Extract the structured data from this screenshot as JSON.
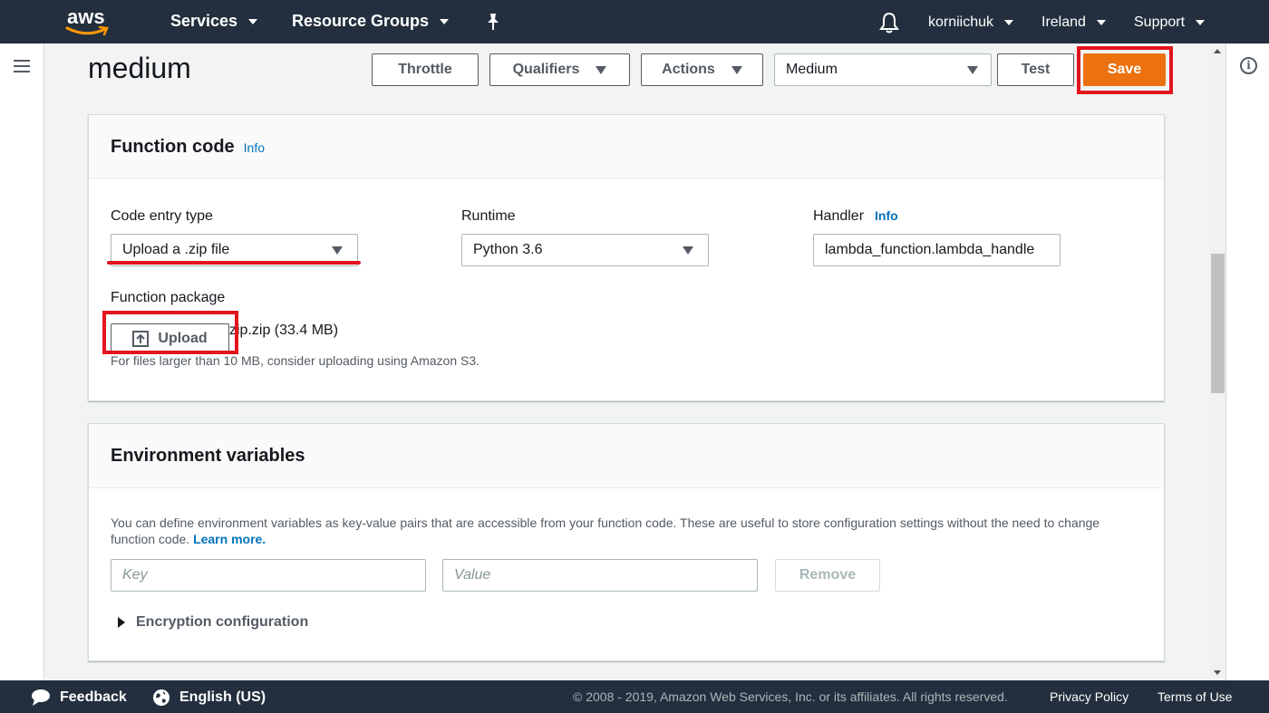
{
  "topnav": {
    "logo": "aws",
    "services": "Services",
    "resource_groups": "Resource Groups",
    "pin_icon": "pin-icon",
    "bell_icon": "bell-icon",
    "user": "korniichuk",
    "region": "Ireland",
    "support": "Support"
  },
  "page": {
    "title": "medium",
    "buttons": {
      "throttle": "Throttle",
      "qualifiers": "Qualifiers",
      "actions": "Actions",
      "test": "Test",
      "save": "Save"
    },
    "test_event_select": "Medium"
  },
  "function_code": {
    "title": "Function code",
    "info": "Info",
    "code_entry_label": "Code entry type",
    "code_entry_value": "Upload a .zip file",
    "runtime_label": "Runtime",
    "runtime_value": "Python 3.6",
    "handler_label": "Handler",
    "handler_info": "Info",
    "handler_value": "lambda_function.lambda_handle",
    "package_label": "Function package",
    "upload_label": "Upload",
    "file_text": "zip.zip (33.4 MB)",
    "help": "For files larger than 10 MB, consider uploading using Amazon S3."
  },
  "env_vars": {
    "title": "Environment variables",
    "description": "You can define environment variables as key-value pairs that are accessible from your function code. These are useful to store configuration settings without the need to change function code.",
    "learn_more": "Learn more.",
    "key_placeholder": "Key",
    "value_placeholder": "Value",
    "remove": "Remove",
    "encryption": "Encryption configuration"
  },
  "footer": {
    "feedback": "Feedback",
    "language": "English (US)",
    "copyright": "© 2008 - 2019, Amazon Web Services, Inc. or its affiliates. All rights reserved.",
    "privacy": "Privacy Policy",
    "terms": "Terms of Use"
  },
  "colors": {
    "nav_bg": "#232f3e",
    "save_orange": "#ec7211",
    "highlight_red": "#e3141e",
    "link_blue": "#0073bb"
  }
}
